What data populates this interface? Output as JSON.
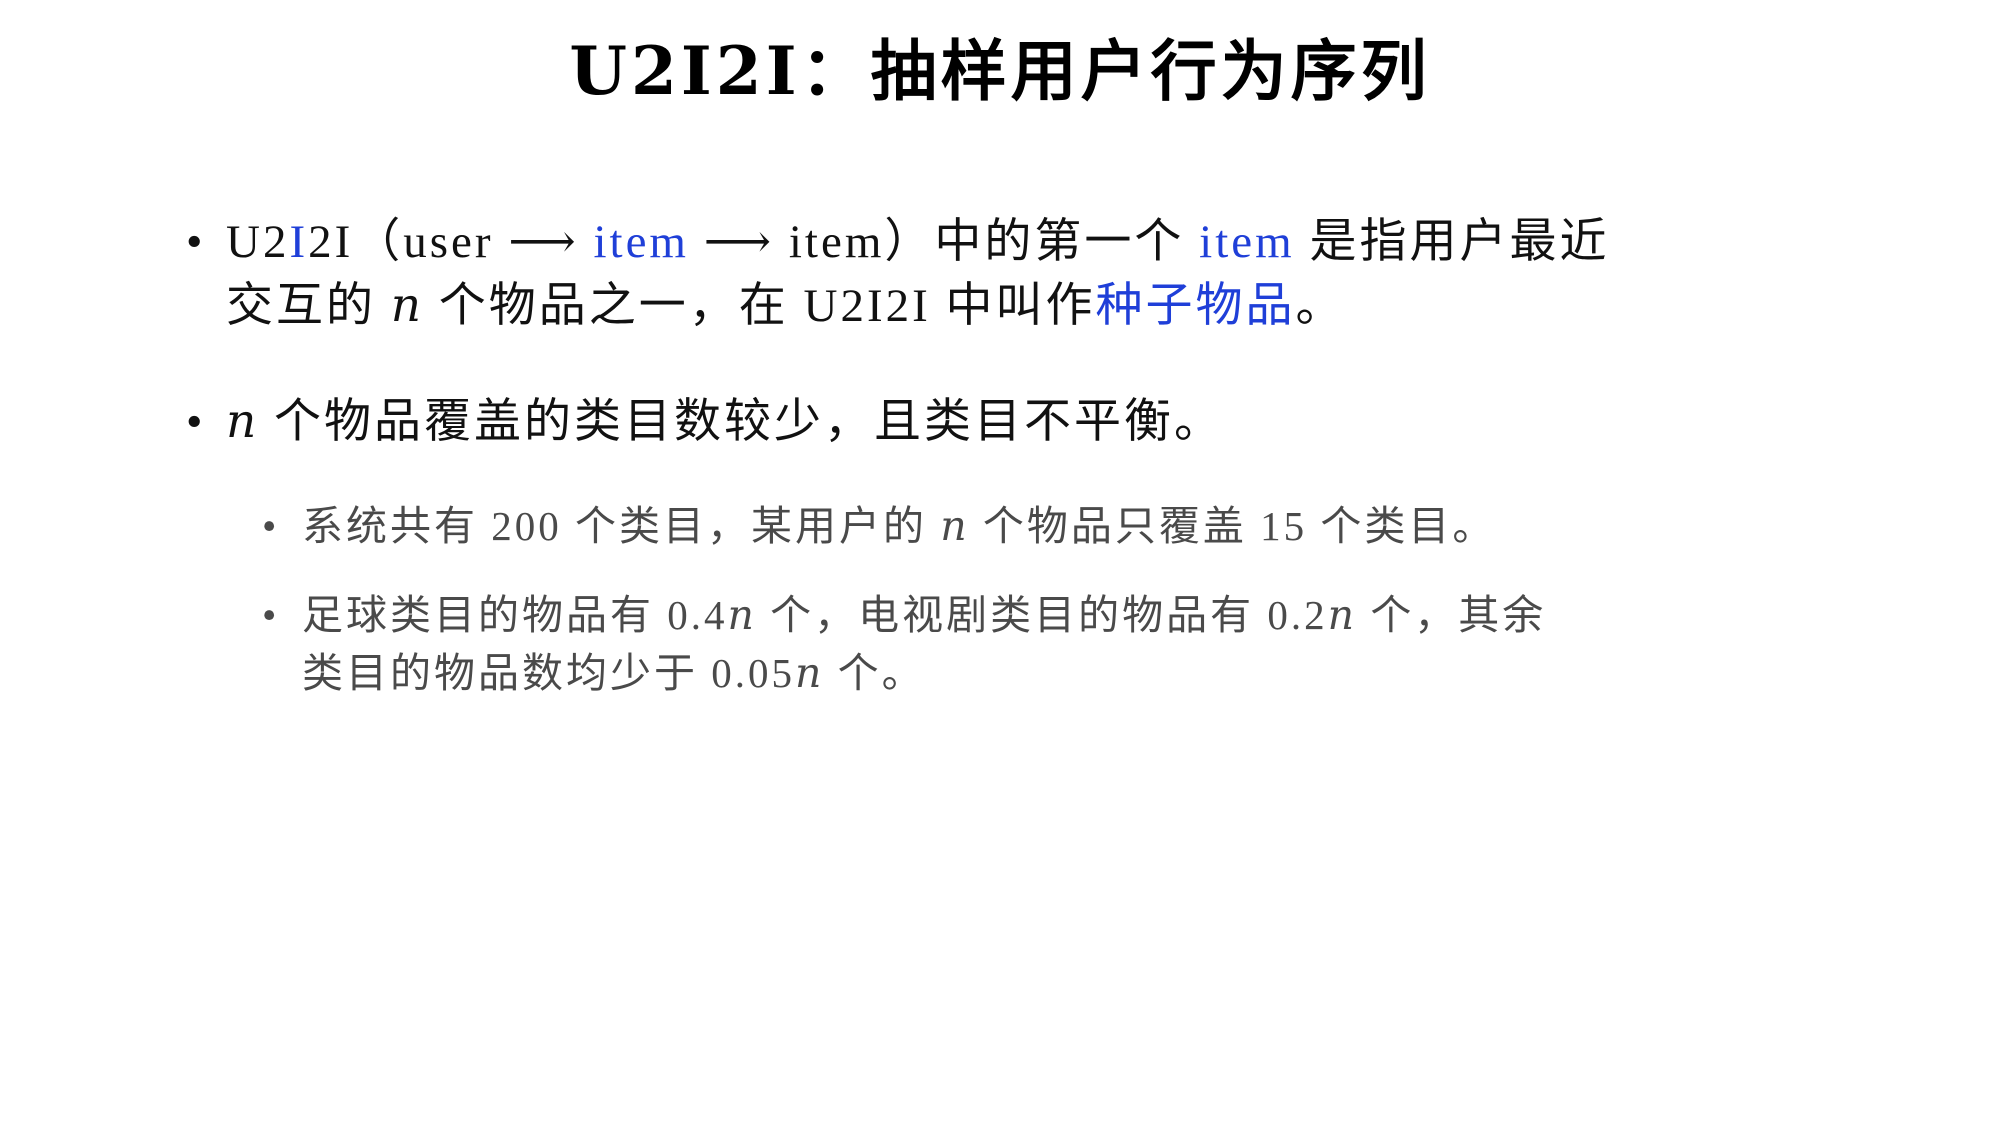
{
  "title": "U2I2I：抽样用户行为序列",
  "bullets": {
    "b1": {
      "l1_p1": "U2",
      "l1_p2": "I",
      "l1_p3": "2I（user ⟶ ",
      "l1_p4": "item",
      "l1_p5": " ⟶ item）中的第一个 ",
      "l1_p6": "item",
      "l1_p7": " 是指用户最近",
      "l2_p1": "交互的 ",
      "l2_n": "n",
      "l2_p2": " 个物品之一，在 U2I2I 中叫作",
      "l2_p3": "种子物品",
      "l2_p4": "。"
    },
    "b2": {
      "n": "n",
      "text": " 个物品覆盖的类目数较少，且类目不平衡。"
    },
    "b2_sub1": {
      "p1": "系统共有 200 个类目，某用户的 ",
      "n": "n",
      "p2": " 个物品只覆盖 15 个类目。"
    },
    "b2_sub2": {
      "l1_p1": "足球类目的物品有 0.4",
      "l1_n1": "n",
      "l1_p2": " 个，电视剧类目的物品有 0.2",
      "l1_n2": "n",
      "l1_p3": " 个，其余",
      "l2_p1": "类目的物品数均少于 0.05",
      "l2_n": "n",
      "l2_p2": " 个。"
    }
  },
  "bullet_symbol": "•",
  "colors": {
    "highlight": "#1f3fd8",
    "text": "#111111",
    "subtext": "#4a4a4a"
  }
}
